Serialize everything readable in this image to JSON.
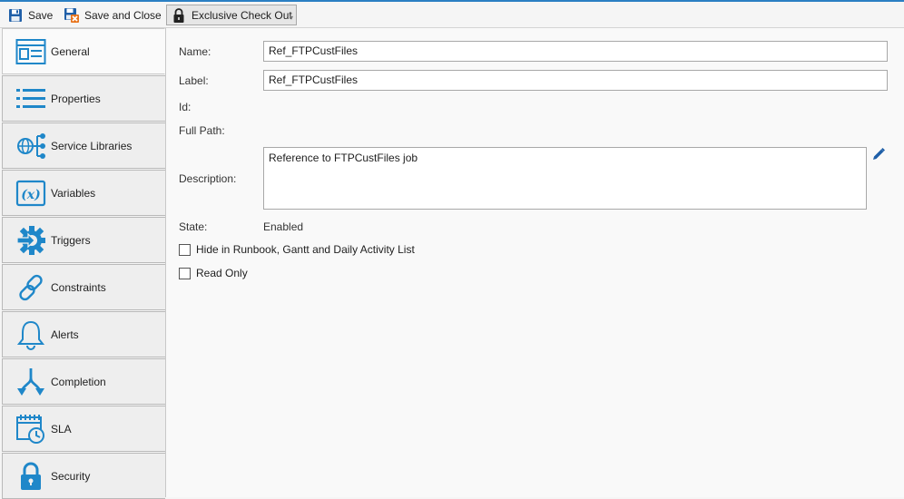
{
  "toolbar": {
    "save_label": "Save",
    "save_close_label": "Save and Close",
    "checkout_label": "Exclusive Check Out"
  },
  "sidebar": {
    "items": [
      {
        "label": "General",
        "icon": "general-form-icon"
      },
      {
        "label": "Properties",
        "icon": "list-icon"
      },
      {
        "label": "Service Libraries",
        "icon": "globe-network-icon"
      },
      {
        "label": "Variables",
        "icon": "variable-x-icon"
      },
      {
        "label": "Triggers",
        "icon": "gear-arrow-icon"
      },
      {
        "label": "Constraints",
        "icon": "link-icon"
      },
      {
        "label": "Alerts",
        "icon": "bell-icon"
      },
      {
        "label": "Completion",
        "icon": "split-arrows-icon"
      },
      {
        "label": "SLA",
        "icon": "calendar-clock-icon"
      },
      {
        "label": "Security",
        "icon": "lock-icon"
      }
    ]
  },
  "form": {
    "name_label": "Name:",
    "name_value": "Ref_FTPCustFiles",
    "label_label": "Label:",
    "label_value": "Ref_FTPCustFiles",
    "id_label": "Id:",
    "full_path_label": "Full Path:",
    "description_label": "Description:",
    "description_value": "Reference to FTPCustFiles job",
    "state_label": "State:",
    "state_value": "Enabled",
    "hide_label": "Hide in Runbook, Gantt and Daily Activity List",
    "hide_checked": false,
    "readonly_label": "Read Only",
    "readonly_checked": false
  },
  "colors": {
    "accent": "#1f87c9",
    "top_border": "#2b7fc3"
  }
}
